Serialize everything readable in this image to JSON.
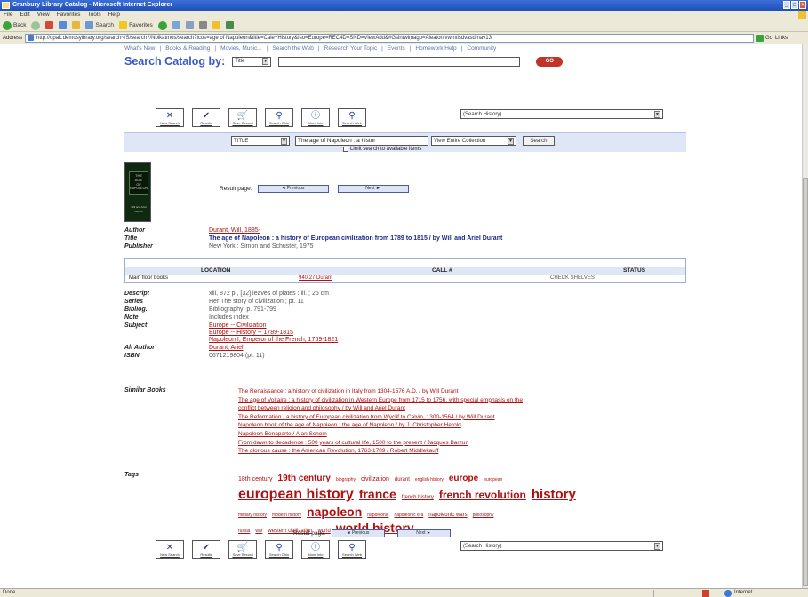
{
  "window": {
    "title": "Cranbury Library Catalog - Microsoft Internet Explorer"
  },
  "menu": [
    "File",
    "Edit",
    "View",
    "Favorites",
    "Tools",
    "Help"
  ],
  "toolbar": {
    "back": "Back",
    "search": "Search",
    "favorites": "Favorites"
  },
  "address": {
    "label": "Address",
    "url": "http://opak.demosylbrary.org/search~/S/search?/Nolkatmos/search?lcos=age of Napoleon&title=Cale+History&Iso=Europe=REC4D=SND=ViewAdd&#Gsintwimagp=Aleaton.vwIntlsdvasd.nav13",
    "go": "Go",
    "links": "Links"
  },
  "nav_tabs": [
    "What's New",
    "Books & Reading",
    "Movies, Music...",
    "Search the Web",
    "Research Your Topic",
    "Events",
    "Homework Help",
    "Community"
  ],
  "search": {
    "label": "Search Catalog by:",
    "type": "Title",
    "go": "GO"
  },
  "icon_buttons": [
    {
      "icon": "x-icon",
      "label": "New Search"
    },
    {
      "icon": "check-icon",
      "label": "Results"
    },
    {
      "icon": "cart-icon",
      "label": "Save Record"
    },
    {
      "icon": "binoculars-icon",
      "label": "Search Ohio"
    },
    {
      "icon": "info-icon",
      "label": "More Info"
    },
    {
      "icon": "magnifier-icon",
      "label": "Search Web"
    }
  ],
  "history_select": "(Search History)",
  "refine": {
    "field": "TITLE",
    "query": "The age of Napoleon : a histor",
    "scope": "View Entire Collection",
    "button": "Search",
    "limit": "Limit search to available items"
  },
  "book_cover": {
    "lines": [
      "THE",
      "AGE",
      "OF",
      "NAPOLEON",
      "Will and Ariel Durant"
    ]
  },
  "result_page": {
    "label": "Result page:",
    "prev": "◄ Previous",
    "next": "Next ►"
  },
  "record": {
    "author": {
      "label": "Author",
      "value": "Durant, Will, 1885-"
    },
    "title": {
      "label": "Title",
      "value": "The age of Napoleon : a history of European civilization from 1789 to 1815 / by Will and Ariel Durant"
    },
    "publisher": {
      "label": "Publisher",
      "value": "New York : Simon and Schuster, 1975"
    }
  },
  "holdings": {
    "headers": [
      "LOCATION",
      "CALL #",
      "STATUS"
    ],
    "rows": [
      {
        "location": "Main floor books",
        "call": "940.27 Durant",
        "status": "CHECK SHELVES"
      }
    ]
  },
  "details": [
    {
      "label": "Descript",
      "values": [
        "xiii, 872 p., [32] leaves of plates : ill. ; 25 cm"
      ],
      "link": false
    },
    {
      "label": "Series",
      "values": [
        "Her The story of civilization ; pt. 11"
      ],
      "link": false
    },
    {
      "label": "Bibliog.",
      "values": [
        "Bibliography: p. 791-799"
      ],
      "link": false
    },
    {
      "label": "Note",
      "values": [
        "Includes index"
      ],
      "link": false
    },
    {
      "label": "Subject",
      "values": [
        "Europe -- Civilization",
        "Europe -- History -- 1789-1815",
        "Napoleon I, Emperor of the French, 1769-1821"
      ],
      "link": true
    },
    {
      "label": "Alt Author",
      "values": [
        "Durant, Ariel"
      ],
      "link": true
    },
    {
      "label": "ISBN",
      "values": [
        "0671219804 (pt. 11)"
      ],
      "link": false
    }
  ],
  "similar": {
    "label": "Similar Books",
    "items": [
      "The Renaissance : a history of civilization in Italy from 1304-1576 A.D. / by Will Durant",
      "The age of Voltaire : a history of civilization in Western Europe from 1715 to 1756, with special emphasis on the",
      "conflict between religion and philosophy / by Will and Ariel Durant",
      "The Reformation : a history of European civilization from Wyclif to Calvin, 1300-1564 / by Will Durant",
      "Napoleon book of the age of Napoleon : the age of Napoleon / by J. Christopher Herold",
      "Napoleon Bonaparte / Alan Schom",
      "From dawn to decadence : 500 years of cultural life, 1500 to the present / Jacques Barzun",
      "The glorious cause : the American Revolution, 1763-1789 / Robert Middlekauff"
    ]
  },
  "tags": {
    "label": "Tags",
    "lines": [
      [
        {
          "t": "18th century",
          "s": 7
        },
        {
          "t": "19th century",
          "s": 10
        },
        {
          "t": "biography",
          "s": 5
        },
        {
          "t": "civilization",
          "s": 7
        },
        {
          "t": "durant",
          "s": 6
        },
        {
          "t": "english history",
          "s": 5
        },
        {
          "t": "europe",
          "s": 10
        },
        {
          "t": "european",
          "s": 5
        }
      ],
      [
        {
          "t": "european history",
          "s": 16
        },
        {
          "t": "france",
          "s": 14
        },
        {
          "t": "french history",
          "s": 6
        },
        {
          "t": "french revolution",
          "s": 12
        },
        {
          "t": "history",
          "s": 15
        }
      ],
      [
        {
          "t": "military history",
          "s": 5
        },
        {
          "t": "modern history",
          "s": 5
        },
        {
          "t": "napoleon",
          "s": 14
        },
        {
          "t": "napoleonic",
          "s": 5
        },
        {
          "t": "napoleonic era",
          "s": 5
        },
        {
          "t": "napoleonic wars",
          "s": 6
        },
        {
          "t": "philosophy",
          "s": 5
        }
      ],
      [
        {
          "t": "russia",
          "s": 5
        },
        {
          "t": "war",
          "s": 5
        },
        {
          "t": "western civilization",
          "s": 6
        },
        {
          "t": "world",
          "s": 6
        },
        {
          "t": "world history",
          "s": 14
        }
      ]
    ]
  },
  "status": {
    "done": "Done",
    "zone": "Internet"
  }
}
